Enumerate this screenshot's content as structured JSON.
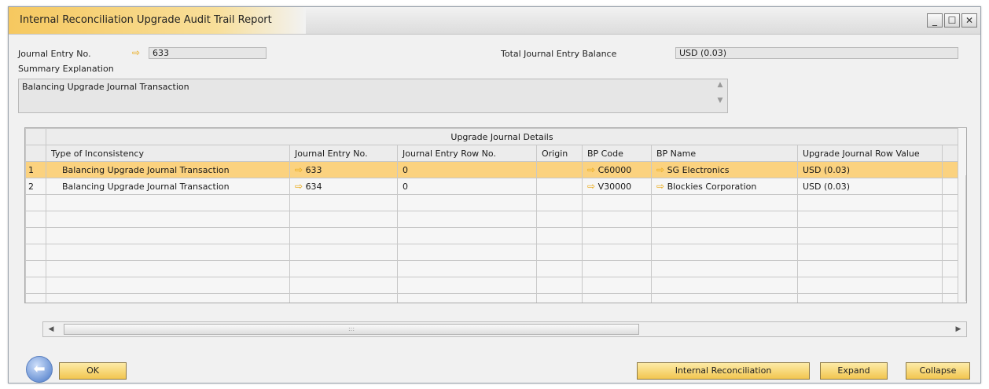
{
  "window": {
    "title": "Internal Reconciliation Upgrade Audit Trail Report"
  },
  "header": {
    "je_label": "Journal Entry No.",
    "je_value": "633",
    "total_label": "Total Journal Entry Balance",
    "total_value": "USD (0.03)",
    "summary_label": "Summary Explanation",
    "summary_value": "Balancing Upgrade Journal Transaction"
  },
  "grid": {
    "group_title": "Upgrade Journal Details",
    "columns": [
      "Type of Inconsistency",
      "Journal Entry No.",
      "Journal Entry Row No.",
      "Origin",
      "BP Code",
      "BP Name",
      "Upgrade Journal Row Value"
    ],
    "rows": [
      {
        "num": "1",
        "type": "Balancing Upgrade Journal Transaction",
        "je": "633",
        "row": "0",
        "origin": "",
        "bp_code": "C60000",
        "bp_name": "SG Electronics",
        "value": "USD (0.03)"
      },
      {
        "num": "2",
        "type": "Balancing Upgrade Journal Transaction",
        "je": "634",
        "row": "0",
        "origin": "",
        "bp_code": "V30000",
        "bp_name": "Blockies Corporation",
        "value": "USD (0.03)"
      }
    ]
  },
  "buttons": {
    "ok": "OK",
    "internal": "Internal Reconciliation",
    "expand": "Expand",
    "collapse": "Collapse"
  },
  "icons": {
    "link_arrow": "link-arrow-icon",
    "back": "back-icon"
  },
  "colors": {
    "accent": "#f2c650",
    "selected_row": "#fbd27f",
    "link_arrow": "#e9a60c"
  }
}
